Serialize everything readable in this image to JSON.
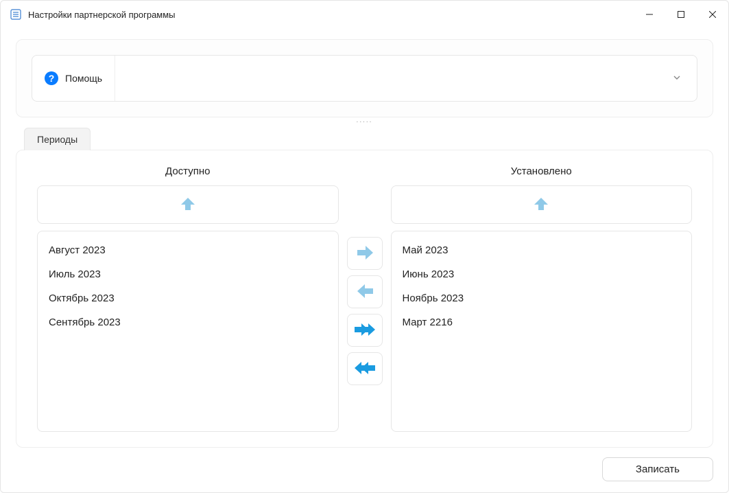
{
  "window": {
    "title": "Настройки партнерской программы"
  },
  "help": {
    "label": "Помощь"
  },
  "tabs": {
    "periods": "Периоды"
  },
  "columns": {
    "available": "Доступно",
    "installed": "Установлено"
  },
  "available_items": [
    "Август 2023",
    "Июль 2023",
    "Октябрь 2023",
    "Сентябрь 2023"
  ],
  "installed_items": [
    "Май 2023",
    "Июнь 2023",
    "Ноябрь 2023",
    "Март 2216"
  ],
  "footer": {
    "save": "Записать"
  },
  "colors": {
    "accent_light": "#8fc9e8",
    "accent": "#1a9be0"
  },
  "splitter_dots": "....."
}
